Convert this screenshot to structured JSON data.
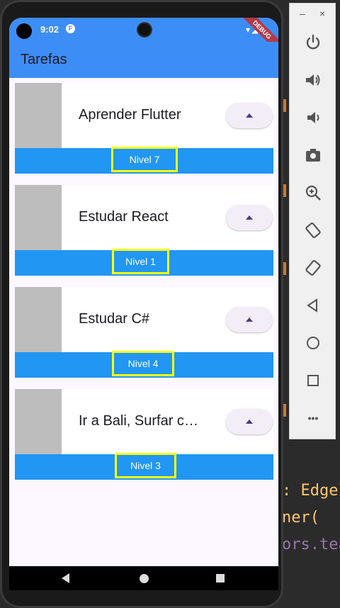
{
  "status_bar": {
    "time": "9:02",
    "debug_label": "DEBUG"
  },
  "app_bar": {
    "title": "Tarefas"
  },
  "tasks": [
    {
      "title": "Aprender Flutter",
      "level_label": "Nivel 7"
    },
    {
      "title": "Estudar React",
      "level_label": "Nivel 1"
    },
    {
      "title": "Estudar C#",
      "level_label": "Nivel 4"
    },
    {
      "title": "Ir a Bali, Surfar com a galera",
      "level_label": "Nivel 3"
    }
  ],
  "ide_code": {
    "line1": ": EdgeI",
    "line2": "ner(",
    "line3": "ors.tea"
  },
  "emulator": {
    "minimize_label": "–",
    "close_label": "×",
    "more_label": "•••"
  },
  "colors": {
    "app_bar": "#3d8df7",
    "level_bar": "#2196f3",
    "highlight_border": "#ffff00",
    "image_placeholder": "#bdbdbd"
  }
}
